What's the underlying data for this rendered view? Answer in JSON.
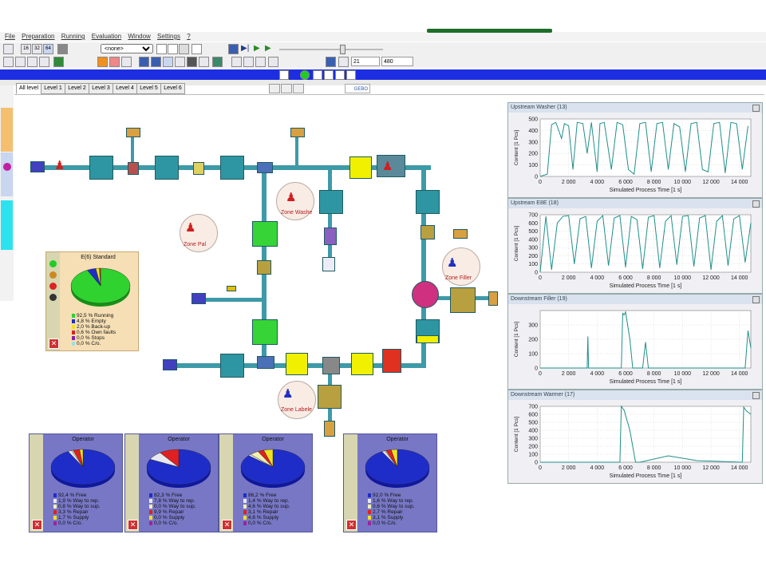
{
  "menu": [
    "File",
    "Preparation",
    "Running",
    "Evaluation",
    "Window",
    "Settings",
    "?"
  ],
  "toolbar": {
    "zoom_levels": [
      "16",
      "32",
      "64"
    ],
    "layout_select": "<none>",
    "field_a": "21",
    "field_b": "480"
  },
  "branding": "GEBO",
  "tabs": [
    "All level",
    "Level 1",
    "Level 2",
    "Level 3",
    "Level 4",
    "Level 5",
    "Level 6"
  ],
  "zones": {
    "washer": "Zone Washe",
    "pal": "Zone Pal",
    "filler": "Zone Filler",
    "labeler": "Zone Labele"
  },
  "standard_panel": {
    "title": "E(6) Standard",
    "legend": [
      "92,5 % Running",
      "4,8 % Empty",
      "2,0 % Back-up",
      "0,6 % Own faults",
      "0,0 % Stops",
      "0,0 % C/o."
    ],
    "values": [
      92.5,
      4.8,
      2.0,
      0.6,
      0.0,
      0.0
    ],
    "colors": [
      "#2fd22f",
      "#1f2dc8",
      "#f0e020",
      "#e02020",
      "#8a20a0",
      "#a0e0e0"
    ]
  },
  "operators": [
    {
      "title": "Operator",
      "legend": [
        "92,4 % Free",
        "1,9 % Way to rep.",
        "0,8 % Way to sup.",
        "3,3 % Repair",
        "1,7 % Supply",
        "0,0 % C/o."
      ],
      "values": [
        92.4,
        1.9,
        0.8,
        3.3,
        1.7,
        0.0
      ]
    },
    {
      "title": "Operator",
      "legend": [
        "82,3 % Free",
        "7,8 % Way to rep.",
        "0,0 % Way to sup.",
        "9,9 % Repair",
        "0,0 % Supply",
        "0,0 % C/o."
      ],
      "values": [
        82.3,
        7.8,
        0.0,
        9.9,
        0.0,
        0.0
      ]
    },
    {
      "title": "Operator",
      "legend": [
        "86,2 % Free",
        "1,4 % Way to rep.",
        "4,6 % Way to sup.",
        "3,1 % Repair",
        "4,6 % Supply",
        "0,0 % C/o."
      ],
      "values": [
        86.2,
        1.4,
        4.6,
        3.1,
        4.6,
        0.0
      ]
    },
    {
      "title": "Operator",
      "legend": [
        "92,0 % Free",
        "1,6 % Way to rep.",
        "0,6 % Way to sup.",
        "2,7 % Repair",
        "3,1 % Supply",
        "0,0 % C/o."
      ],
      "values": [
        92.0,
        1.6,
        0.6,
        2.7,
        3.1,
        0.0
      ]
    }
  ],
  "operator_colors": [
    "#1f2dc8",
    "#e8e8f0",
    "#f0f0b0",
    "#e02020",
    "#f0e020",
    "#a020a0"
  ],
  "chart_data": [
    {
      "type": "line",
      "title": "Upstream Washer (13)",
      "xlabel": "Simulated Process Time [1 s]",
      "ylabel": "Content [1 Pcs]",
      "ylim": [
        0,
        500
      ],
      "xlim": [
        0,
        14800
      ],
      "yticks": [
        "500",
        "400",
        "300",
        "200",
        "100",
        "0"
      ],
      "xticks": [
        "0",
        "2 000",
        "4 000",
        "6 000",
        "8 000",
        "10 000",
        "12 000",
        "14 000"
      ],
      "series": [
        {
          "x": [
            0,
            500,
            800,
            1100,
            1500,
            1700,
            2000,
            2300,
            2600,
            3000,
            3300,
            3600,
            4000,
            4200,
            4500,
            5000,
            5400,
            5800,
            6200,
            6600,
            7000,
            7400,
            7800,
            8200,
            8600,
            9000,
            9400,
            9800,
            10200,
            10600,
            11000,
            11400,
            11800,
            12200,
            12600,
            13000,
            13400,
            13800,
            14200,
            14600
          ],
          "y": [
            0,
            20,
            450,
            470,
            330,
            460,
            440,
            60,
            470,
            460,
            200,
            470,
            40,
            460,
            470,
            60,
            470,
            450,
            60,
            20,
            460,
            470,
            40,
            460,
            470,
            60,
            460,
            430,
            40,
            460,
            470,
            60,
            40,
            460,
            470,
            30,
            470,
            460,
            60,
            440
          ]
        }
      ]
    },
    {
      "type": "line",
      "title": "Upstream E8E (18)",
      "xlabel": "Simulated Process Time [1 s]",
      "ylabel": "Content [1 Pcs]",
      "ylim": [
        0,
        700
      ],
      "xlim": [
        0,
        14800
      ],
      "yticks": [
        "700",
        "600",
        "500",
        "400",
        "300",
        "200",
        "100",
        "0"
      ],
      "xticks": [
        "0",
        "2 000",
        "4 000",
        "6 000",
        "8 000",
        "10 000",
        "12 000",
        "14 000"
      ],
      "series": [
        {
          "x": [
            0,
            400,
            800,
            1200,
            1600,
            2000,
            2400,
            2800,
            3200,
            3600,
            4000,
            4400,
            4800,
            5200,
            5600,
            6000,
            6400,
            6800,
            7200,
            7600,
            8000,
            8400,
            8800,
            9200,
            9600,
            10000,
            10400,
            10800,
            11200,
            11600,
            12000,
            12400,
            12800,
            13200,
            13600,
            14000,
            14400,
            14800
          ],
          "y": [
            0,
            680,
            30,
            600,
            680,
            690,
            100,
            650,
            680,
            50,
            620,
            690,
            80,
            660,
            690,
            60,
            680,
            640,
            40,
            670,
            690,
            50,
            620,
            690,
            90,
            680,
            690,
            70,
            660,
            690,
            30,
            620,
            690,
            80,
            650,
            690,
            120,
            600
          ]
        }
      ]
    },
    {
      "type": "line",
      "title": "Downstream Filler (19)",
      "xlabel": "Simulated Process Time [1 s]",
      "ylabel": "Content [1 Pcs]",
      "ylim": [
        0,
        400
      ],
      "xlim": [
        0,
        14800
      ],
      "yticks": [
        "300",
        "200",
        "100",
        "0"
      ],
      "xticks": [
        "0",
        "2 000",
        "4 000",
        "6 000",
        "8 000",
        "10 000",
        "12 000",
        "14 000"
      ],
      "series": [
        {
          "x": [
            0,
            3300,
            3350,
            3400,
            5700,
            5800,
            5900,
            6000,
            6300,
            6500,
            7200,
            7400,
            7600,
            12000,
            12500,
            13000,
            14400,
            14600,
            14800
          ],
          "y": [
            0,
            0,
            220,
            0,
            0,
            380,
            370,
            390,
            200,
            0,
            0,
            180,
            0,
            0,
            0,
            0,
            0,
            260,
            140
          ]
        }
      ]
    },
    {
      "type": "line",
      "title": "Downstream Warmer (17)",
      "xlabel": "Simulated Process Time [1 s]",
      "ylabel": "Content [1 Pcs]",
      "ylim": [
        0,
        700
      ],
      "xlim": [
        0,
        14800
      ],
      "yticks": [
        "700",
        "600",
        "500",
        "400",
        "300",
        "200",
        "100",
        "0"
      ],
      "xticks": [
        "0",
        "2 000",
        "4 000",
        "6 000",
        "8 000",
        "10 000",
        "12 000",
        "14 000"
      ],
      "series": [
        {
          "x": [
            0,
            5600,
            5700,
            5900,
            6300,
            6700,
            7000,
            9000,
            11000,
            14200,
            14300,
            14500,
            14800
          ],
          "y": [
            0,
            0,
            700,
            650,
            400,
            0,
            0,
            80,
            20,
            0,
            690,
            640,
            600
          ]
        }
      ]
    }
  ]
}
